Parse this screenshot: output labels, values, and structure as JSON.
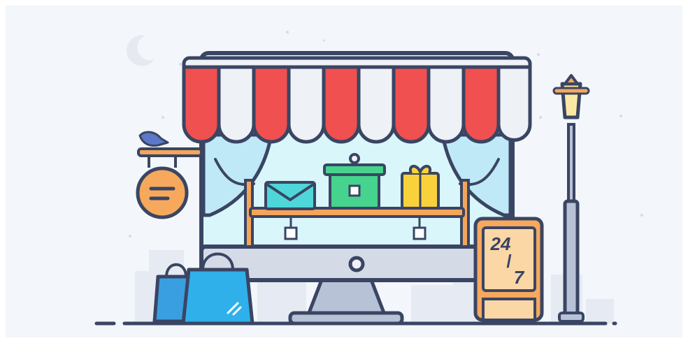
{
  "illustration": {
    "sign_text": "24/7",
    "sign_lines": [
      "24",
      "/",
      "7"
    ]
  },
  "colors": {
    "background": "#f3f6fa",
    "outline": "#3a4563",
    "awning_red": "#f0504f",
    "awning_white": "#eef1f6",
    "window_glass": "#d9f6fb",
    "curtain": "#bfe9f6",
    "shelf": "#f4a55a",
    "bag_blue": "#3a9fe0",
    "sign_orange": "#f6a85c",
    "gift_green": "#46d38d",
    "gift_yellow": "#f9d23b",
    "envelope_teal": "#4fd6d9",
    "moon": "#e2e6ee",
    "lamp_light": "#fbe9a3"
  }
}
